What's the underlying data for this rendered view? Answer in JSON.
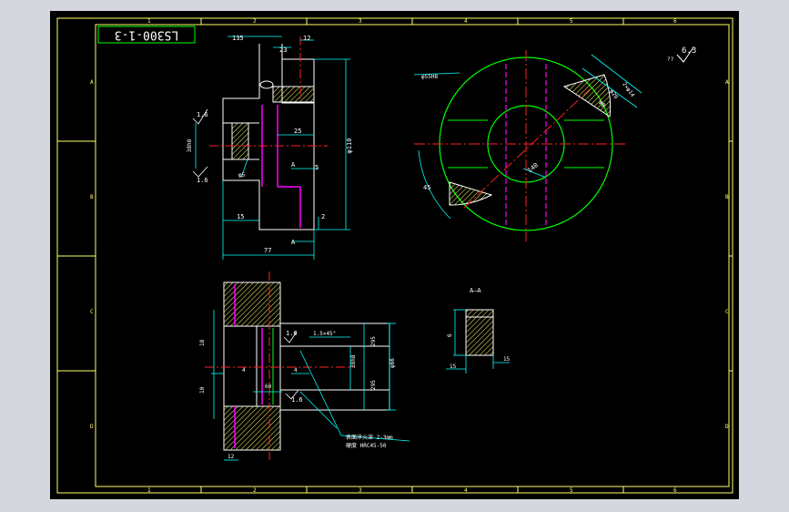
{
  "colors": {
    "background": "#000000",
    "frame": "#ffff66",
    "outline": "#ffffff",
    "body": "#00ff00",
    "center": "#ff2020",
    "hidden": "#ff00ff",
    "dimension": "#00ffff",
    "hatch": "#ffff66"
  },
  "title_box": {
    "drawing_no": "LS300-1-3"
  },
  "zone_letters": [
    "A",
    "B",
    "C",
    "D"
  ],
  "zone_numbers": [
    "1",
    "2",
    "3",
    "4",
    "5",
    "6"
  ],
  "roughness": {
    "corner_value": "6.3",
    "corner_rest": "??",
    "r1": "1.6",
    "r2": "1.6",
    "r3": "1.6",
    "r4": "1.6"
  },
  "top_left_view": {
    "dims": {
      "d135": "135",
      "d23": "23",
      "d12": "12",
      "d35_left": "38h8",
      "d25": "25",
      "d5": "5",
      "d15": "15",
      "d77": "77",
      "d2": "2",
      "phi_right": "φ110",
      "phi_small": "φ5",
      "section_a_top": "A",
      "section_a_bot": "A"
    }
  },
  "circle_view": {
    "dims": {
      "top_left_label": "φ55H8",
      "right_note1": "2×φ14",
      "right_note2": "φ20",
      "right_note3": "φ8",
      "d45": "45",
      "d140": "140"
    }
  },
  "bottom_left_view": {
    "dims": {
      "d18": "18",
      "d10": "10",
      "d4a": "4",
      "d4b": "4",
      "d60": "60",
      "d12": "12",
      "chamfer": "1.5×45°",
      "d295a": "295",
      "d295b": "295",
      "d38": "38h8",
      "phi66": "φ66"
    },
    "note_line1": "表面淬火深 2-3mm",
    "note_line2": "硬度 HRC45-50"
  },
  "section_view": {
    "title": "A—A",
    "dims": {
      "d15a": "15",
      "d15b": "15",
      "d6": "6"
    }
  }
}
